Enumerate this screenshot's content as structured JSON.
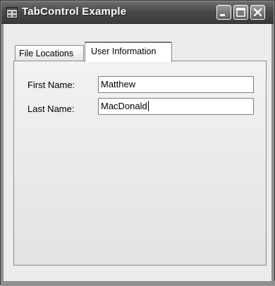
{
  "window": {
    "title": "TabControl Example",
    "icons": {
      "app": "window-app-icon",
      "minimize": "minimize-icon",
      "maximize": "maximize-icon",
      "close": "close-icon"
    }
  },
  "tabs": [
    {
      "label": "File Locations",
      "selected": false
    },
    {
      "label": "User Information",
      "selected": true
    }
  ],
  "form": {
    "first_name": {
      "label": "First Name:",
      "value": "Matthew"
    },
    "last_name": {
      "label": "Last Name:",
      "value": "MacDonald"
    }
  },
  "colors": {
    "title_bar": "#4a4a4a",
    "client_bg": "#ececec"
  }
}
